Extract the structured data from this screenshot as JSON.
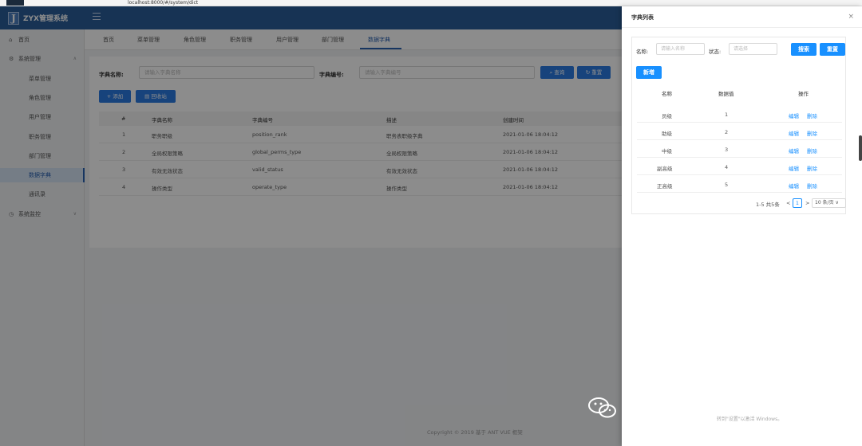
{
  "browser": {
    "url": "localhost:8000/#/system/dict"
  },
  "header": {
    "logo_letter": "J",
    "app_title": "ZYX管理系统"
  },
  "sidebar": {
    "items": [
      {
        "icon": "⌂",
        "label": "首页"
      },
      {
        "icon": "⚙",
        "label": "系统管理",
        "caret": "∧"
      },
      {
        "label": "菜单管理"
      },
      {
        "label": "角色管理"
      },
      {
        "label": "用户管理"
      },
      {
        "label": "职务管理"
      },
      {
        "label": "部门管理"
      },
      {
        "label": "数据字典"
      },
      {
        "label": "通讯录"
      },
      {
        "icon": "◷",
        "label": "系统监控",
        "caret": "∨"
      }
    ]
  },
  "tabs": [
    "首页",
    "菜单管理",
    "角色管理",
    "职务管理",
    "用户管理",
    "部门管理",
    "数据字典"
  ],
  "search": {
    "name_label": "字典名称:",
    "name_placeholder": "请输入字典名称",
    "code_label": "字典编号:",
    "code_placeholder": "请输入字典编号",
    "query_btn": "⌕ 查询",
    "reset_btn": "↻ 重置"
  },
  "actions": {
    "add_btn": "+ 添加",
    "recycle_btn": "▤ 回收站"
  },
  "table": {
    "headers": [
      "#",
      "字典名称",
      "字典编号",
      "描述",
      "创建时间"
    ],
    "rows": [
      [
        "1",
        "职务职级",
        "position_rank",
        "职务表职级字典",
        "2021-01-06 18:04:12"
      ],
      [
        "2",
        "全局权限策略",
        "global_perms_type",
        "全局权限策略",
        "2021-01-06 18:04:12"
      ],
      [
        "3",
        "有效无效状态",
        "valid_status",
        "有效无效状态",
        "2021-01-06 18:04:12"
      ],
      [
        "4",
        "操作类型",
        "operate_type",
        "操作类型",
        "2021-01-06 18:04:12"
      ]
    ]
  },
  "footer": {
    "copyright": "Copyright © 2019 基于 ANT VUE 框架"
  },
  "drawer": {
    "title": "字典列表",
    "close": "×",
    "name_label": "名称:",
    "name_placeholder": "请输入名称",
    "status_label": "状态:",
    "status_placeholder": "请选择",
    "search_btn": "搜索",
    "reset_btn": "重置",
    "new_btn": "新增",
    "headers": [
      "名称",
      "数据值",
      "操作"
    ],
    "rows": [
      [
        "员级",
        "1"
      ],
      [
        "助级",
        "2"
      ],
      [
        "中级",
        "3"
      ],
      [
        "副高级",
        "4"
      ],
      [
        "正高级",
        "5"
      ]
    ],
    "edit_label": "编辑",
    "delete_label": "删除",
    "pager_total": "1-5 共5条",
    "pager_prev": "<",
    "pager_current": "1",
    "pager_next": ">",
    "pager_size": "10 条/页 ∨"
  },
  "watermark": {
    "text": "小儿来一壶枸杞酒泡茶",
    "activate": "转到\"设置\"以激活 Windows。"
  },
  "colors": {
    "header": "#2a5d9a",
    "primary": "#1890ff",
    "active_menu": "#2a62b0"
  }
}
